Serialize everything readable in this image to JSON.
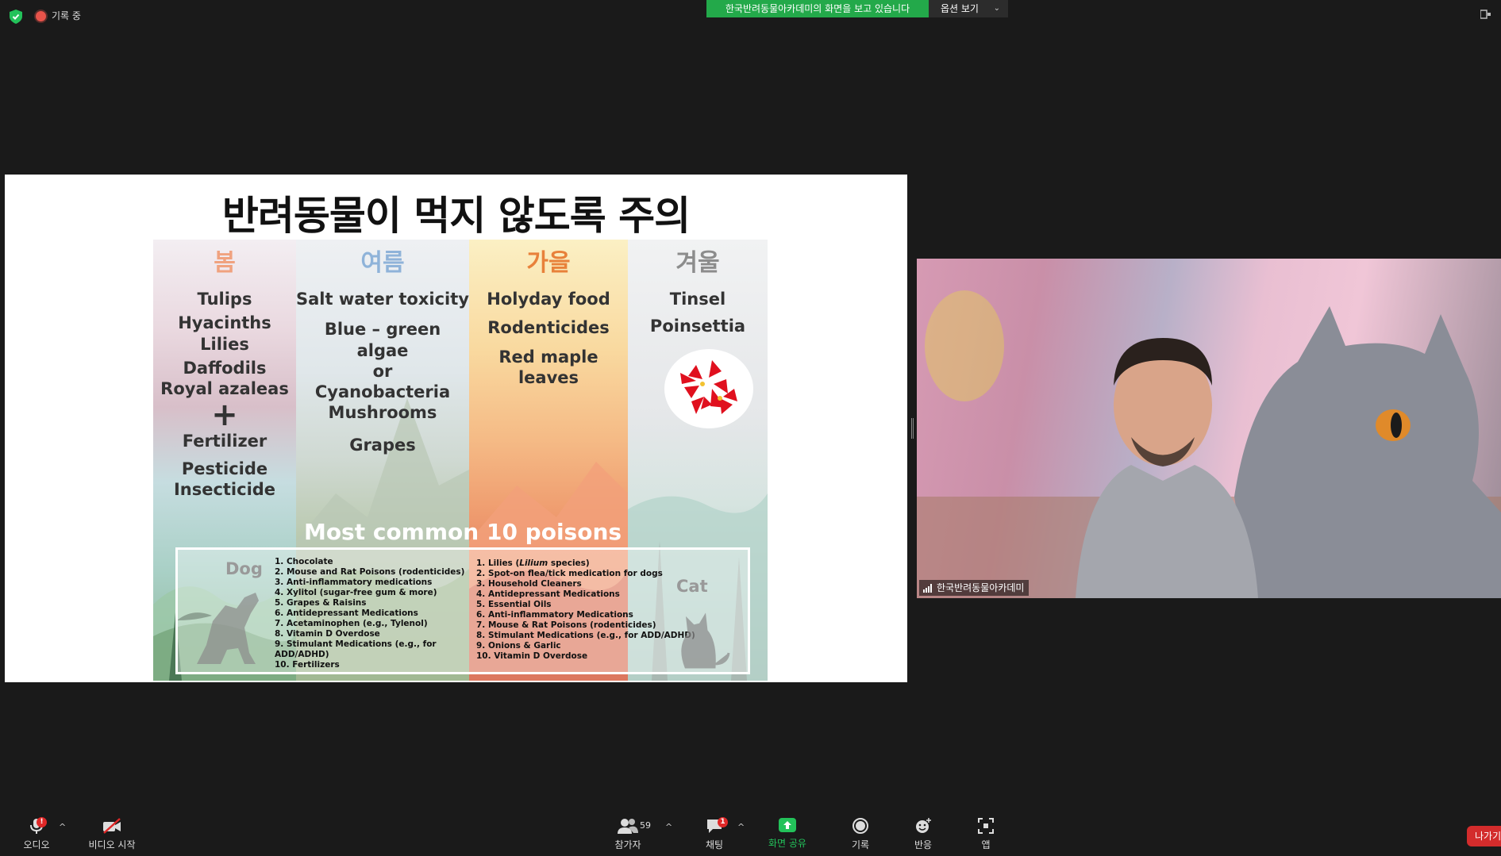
{
  "top_bar": {
    "recording_label": "기록 중",
    "viewing_banner": "한국반려동물아카데미의 화면을 보고 있습니다",
    "view_options_label": "옵션 보기",
    "colors": {
      "banner": "#23a94a",
      "recording": "#e8534a"
    }
  },
  "slide": {
    "title": "반려동물이 먹지 않도록 주의",
    "seasons": [
      {
        "name": "봄",
        "color": "#f0a27f",
        "items": [
          "Tulips",
          "Hyacinths",
          "Lilies",
          "Daffodils",
          "Royal azaleas",
          "+",
          "Fertilizer",
          "Pesticide",
          "Insecticide"
        ]
      },
      {
        "name": "여름",
        "color": "#8fb3d9",
        "items": [
          "Salt water toxicity",
          "Blue – green",
          "algae",
          "or",
          "Cyanobacteria",
          "Mushrooms",
          "Grapes"
        ]
      },
      {
        "name": "가을",
        "color": "#e8813a",
        "items": [
          "Holyday food",
          "Rodenticides",
          "Red maple",
          "leaves"
        ]
      },
      {
        "name": "겨울",
        "color": "#8c8c8c",
        "items": [
          "Tinsel",
          "Poinsettia"
        ]
      }
    ],
    "common_title": "Most common 10 poisons",
    "dog": {
      "label": "Dog",
      "list": [
        "1. Chocolate",
        "2. Mouse and Rat Poisons (rodenticides)",
        "3. Anti-inflammatory medications",
        "4. Xylitol (sugar-free gum & more)",
        "5. Grapes & Raisins",
        "6. Antidepressant Medications",
        "7. Acetaminophen (e.g., Tylenol)",
        "8. Vitamin D Overdose",
        "9. Stimulant Medications (e.g., for",
        "ADD/ADHD)",
        "10. Fertilizers"
      ]
    },
    "cat": {
      "label": "Cat",
      "list_first_prefix": "1. Lilies (",
      "list_first_italic": "Lilium",
      "list_first_suffix": " species)",
      "list": [
        "2. Spot-on flea/tick medication for dogs",
        "3. Household Cleaners",
        "4. Antidepressant Medications",
        "5. Essential Oils",
        "6. Anti-inflammatory Medications",
        "7. Mouse & Rat Poisons (rodenticides)",
        "8. Stimulant Medications (e.g., for ADD/ADHD)",
        "9. Onions & Garlic",
        "10. Vitamin D Overdose"
      ]
    }
  },
  "video": {
    "participant_name": "한국반려동물아카데미"
  },
  "toolbar": {
    "audio_label": "오디오",
    "audio_badge": "!",
    "video_label": "비디오 시작",
    "participants_label": "참가자",
    "participants_count": "59",
    "chat_label": "채팅",
    "chat_badge": "1",
    "share_label": "화면 공유",
    "record_label": "기록",
    "react_label": "반응",
    "apps_label": "앱",
    "leave_label": "나가기",
    "colors": {
      "share": "#23c25a",
      "leave": "#d32c2c"
    }
  }
}
